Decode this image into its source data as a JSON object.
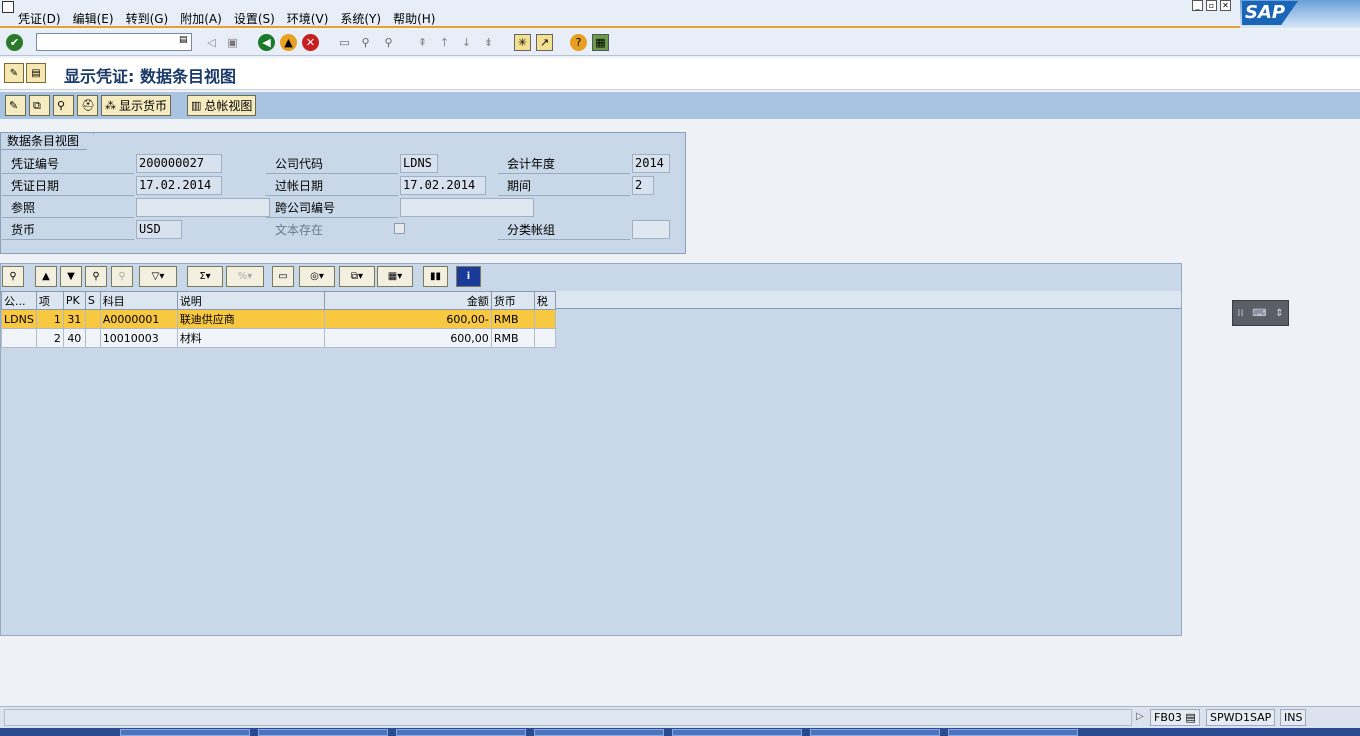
{
  "menu": [
    "凭证(D)",
    "编辑(E)",
    "转到(G)",
    "附加(A)",
    "设置(S)",
    "环境(V)",
    "系统(Y)",
    "帮助(H)"
  ],
  "brand": "SAP",
  "command_field": {
    "value": ""
  },
  "title": "显示凭证: 数据条目视图",
  "app_toolbar": {
    "display_currency": "显示货币",
    "gl_view": "总帐视图"
  },
  "header": {
    "tab": "数据条目视图",
    "doc_no_label": "凭证编号",
    "doc_no": "200000027",
    "company_label": "公司代码",
    "company": "LDNS",
    "fiscal_year_label": "会计年度",
    "fiscal_year": "2014",
    "doc_date_label": "凭证日期",
    "doc_date": "17.02.2014",
    "posting_date_label": "过帐日期",
    "posting_date": "17.02.2014",
    "period_label": "期间",
    "period": "2",
    "reference_label": "参照",
    "reference": "",
    "cross_company_label": "跨公司编号",
    "cross_company": "",
    "currency_label": "货币",
    "currency": "USD",
    "text_exists_label": "文本存在",
    "ledger_group_label": "分类帐组",
    "ledger_group": ""
  },
  "grid": {
    "columns": [
      "公...",
      "项",
      "PK",
      "S",
      "科目",
      "说明",
      "金额",
      "货币",
      "税"
    ],
    "rows": [
      {
        "company": "LDNS",
        "item": "1",
        "pk": "31",
        "s": "",
        "account": "A0000001",
        "desc": "联迪供应商",
        "amount": "600,00-",
        "currency": "RMB",
        "tax": ""
      },
      {
        "company": "",
        "item": "2",
        "pk": "40",
        "s": "",
        "account": "10010003",
        "desc": "材料",
        "amount": "600,00",
        "currency": "RMB",
        "tax": ""
      }
    ]
  },
  "status": {
    "tcode": "FB03",
    "server": "SPWD1SAP",
    "mode": "INS"
  },
  "colors": {
    "accent": "#e8a030",
    "selected_row": "#f8c840",
    "toolbar": "#a8c4e0",
    "panel": "#c8d8e8"
  }
}
